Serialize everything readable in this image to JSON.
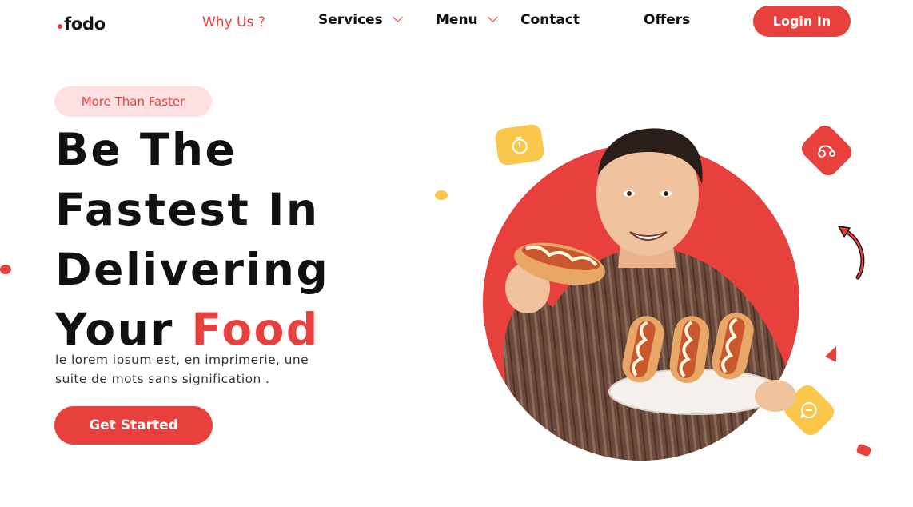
{
  "nav": {
    "logo": "fodo",
    "links": [
      {
        "label": "Why Us ?",
        "active": true
      },
      {
        "label": "Services",
        "dropdown": true
      },
      {
        "label": "Menu",
        "dropdown": true
      },
      {
        "label": "Contact"
      },
      {
        "label": "Offers"
      }
    ],
    "login_label": "Login In"
  },
  "hero": {
    "badge": "More Than Faster",
    "title_lines": [
      "Be The",
      "Fastest In",
      "Delivering",
      "Your"
    ],
    "title_accent": "Food",
    "description": "le lorem ipsum est, en imprimerie, une suite de mots sans signification .",
    "cta_label": "Get Started"
  },
  "colors": {
    "accent": "#e8403c",
    "accent_soft": "#fde0df",
    "yellow": "#fbc74a",
    "text": "#111111"
  },
  "icons": [
    "stopwatch-icon",
    "delivery-scooter-icon",
    "curved-arrow-icon",
    "chat-bubble-icon",
    "play-triangle-icon"
  ]
}
